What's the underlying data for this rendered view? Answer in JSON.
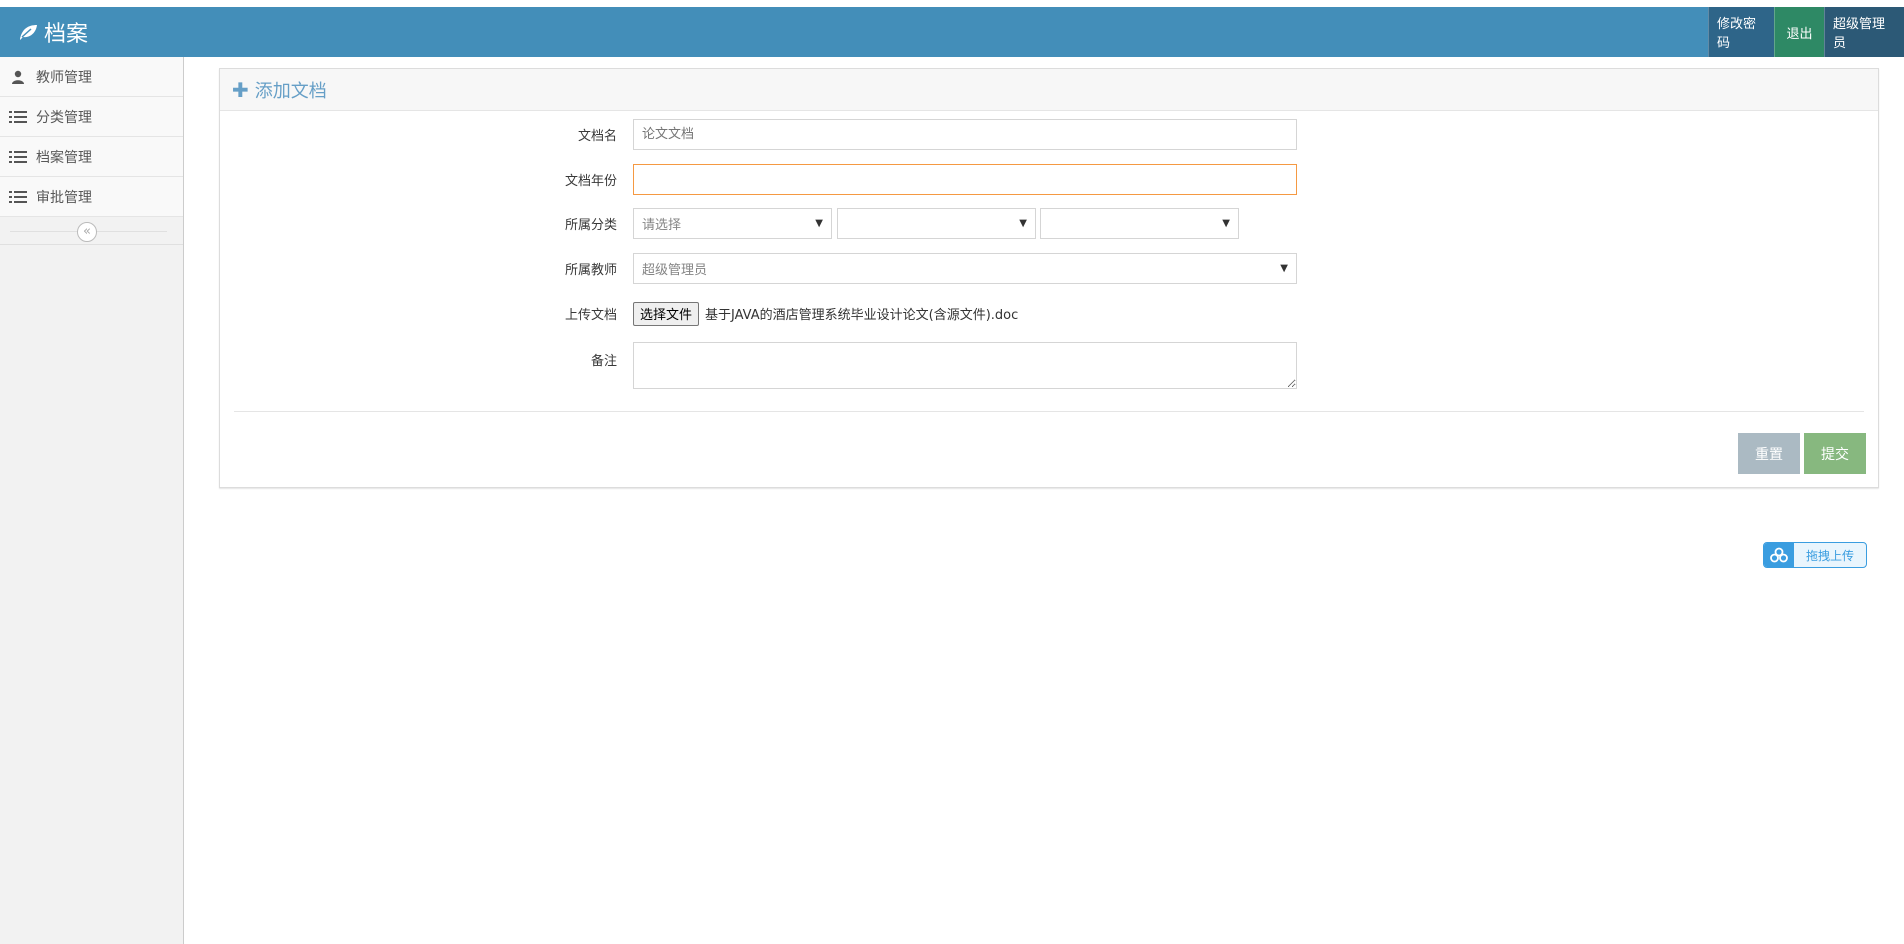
{
  "header": {
    "brand": "档案",
    "change_password": "修改密码",
    "logout": "退出",
    "user": "超级管理员"
  },
  "sidebar": {
    "items": [
      {
        "label": "教师管理",
        "icon": "user-icon"
      },
      {
        "label": "分类管理",
        "icon": "list-icon"
      },
      {
        "label": "档案管理",
        "icon": "list-icon"
      },
      {
        "label": "审批管理",
        "icon": "list-icon"
      }
    ],
    "collapse_glyph": "«"
  },
  "form": {
    "title": "添加文档",
    "doc_name_label": "文档名",
    "doc_name_placeholder": "论文文档",
    "doc_year_label": "文档年份",
    "doc_year_value": "",
    "category_label": "所属分类",
    "category_select_1": "请选择",
    "category_select_2": "",
    "category_select_3": "",
    "teacher_label": "所属教师",
    "teacher_value": "超级管理员",
    "upload_label": "上传文档",
    "choose_file": "选择文件",
    "file_name": "基于JAVA的酒店管理系统毕业设计论文(含源文件).doc",
    "remark_label": "备注",
    "reset": "重置",
    "submit": "提交"
  },
  "drag_upload": {
    "label": "拖拽上传"
  },
  "colors": {
    "topbar": "#438eb9",
    "accent_title": "#669fc7",
    "focus_border": "#f59942",
    "reset_btn": "#abbac3",
    "submit_btn": "#87b87f"
  }
}
